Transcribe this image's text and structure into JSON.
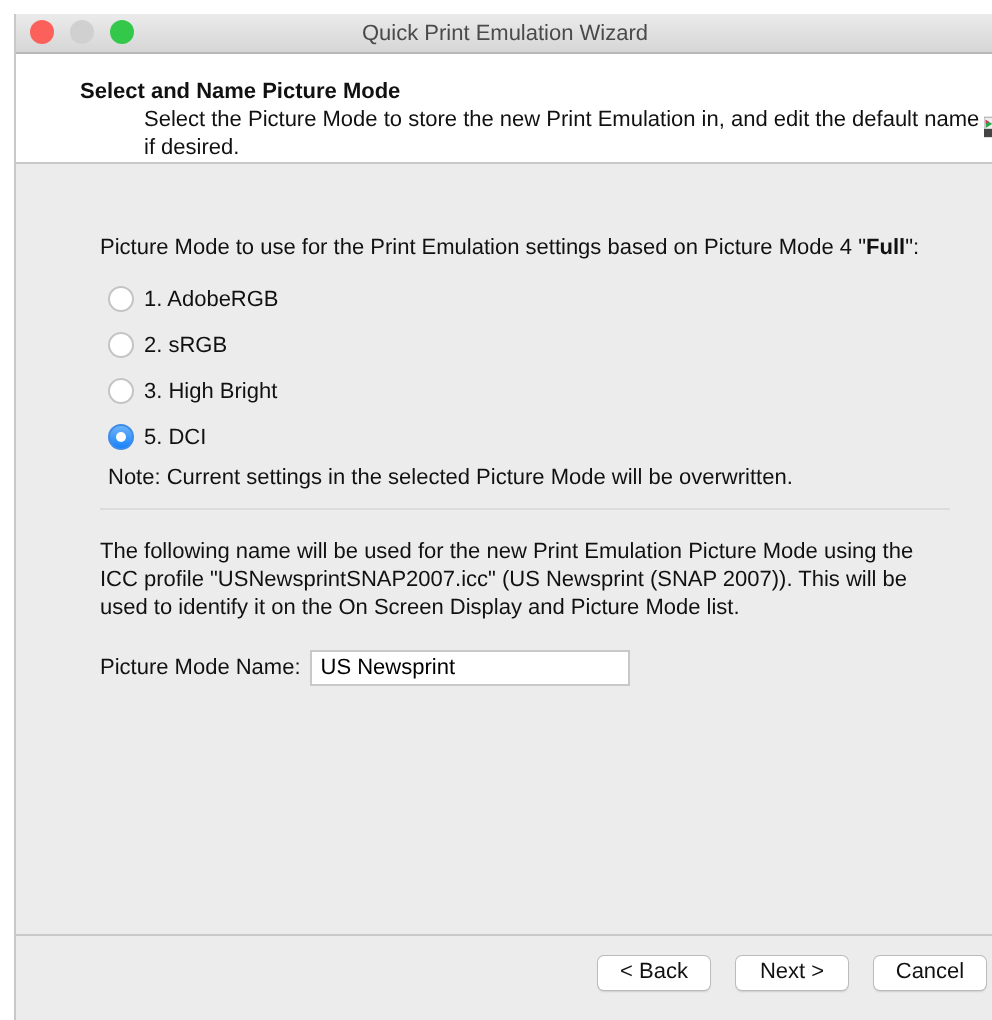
{
  "window": {
    "title": "Quick Print Emulation Wizard"
  },
  "header": {
    "title": "Select and Name Picture Mode",
    "description": "Select the Picture Mode to store the new Print Emulation in, and edit the default name if desired."
  },
  "prompt": "Picture Mode to use for the Print Emulation settings based on Picture Mode 4 \"**Full**\":",
  "options": [
    {
      "label": "1. AdobeRGB",
      "selected": false
    },
    {
      "label": "2. sRGB",
      "selected": false
    },
    {
      "label": "3. High Bright",
      "selected": false
    },
    {
      "label": "5. DCI",
      "selected": true
    }
  ],
  "note": "Note: Current settings in the selected Picture Mode will be overwritten.",
  "explanation": "The following name will be used for the new Print Emulation Picture Mode using the ICC profile \"USNewsprintSNAP2007.icc\" (US Newsprint (SNAP 2007)). This will be used to identify it on the On Screen Display and Picture Mode list.",
  "name_field": {
    "label": "Picture Mode Name:",
    "value": "US Newsprint"
  },
  "buttons": [
    "< Back",
    "Next >",
    "Cancel"
  ]
}
